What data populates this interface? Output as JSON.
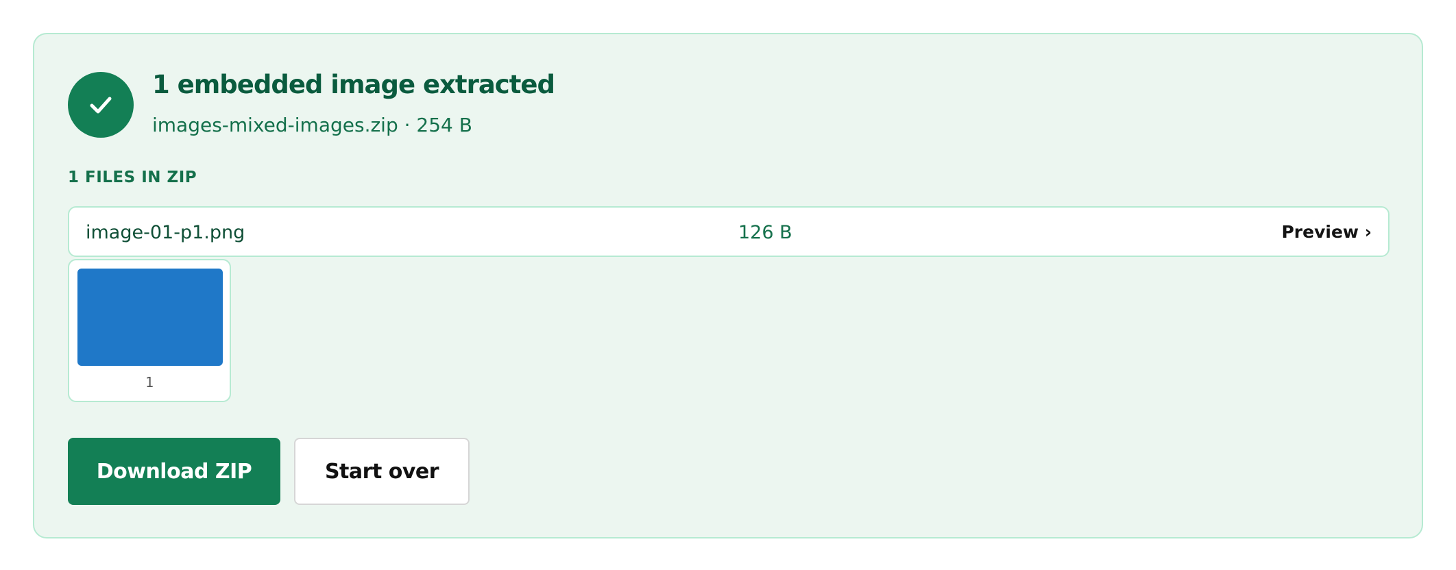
{
  "result": {
    "title": "1 embedded image extracted",
    "subtitle": "images-mixed-images.zip · 254 B",
    "status_icon": "check-icon"
  },
  "files": {
    "section_label": "1 FILES IN ZIP",
    "items": [
      {
        "name": "image-01-p1.png",
        "size": "126 B",
        "preview_label": "Preview ›"
      }
    ]
  },
  "thumbnails": [
    {
      "label": "1",
      "color": "#1f78c8"
    }
  ],
  "actions": {
    "download_label": "Download ZIP",
    "start_over_label": "Start over"
  },
  "colors": {
    "accent": "#137f55",
    "panel_bg": "#ecf6f0",
    "panel_border": "#b6ead2"
  }
}
